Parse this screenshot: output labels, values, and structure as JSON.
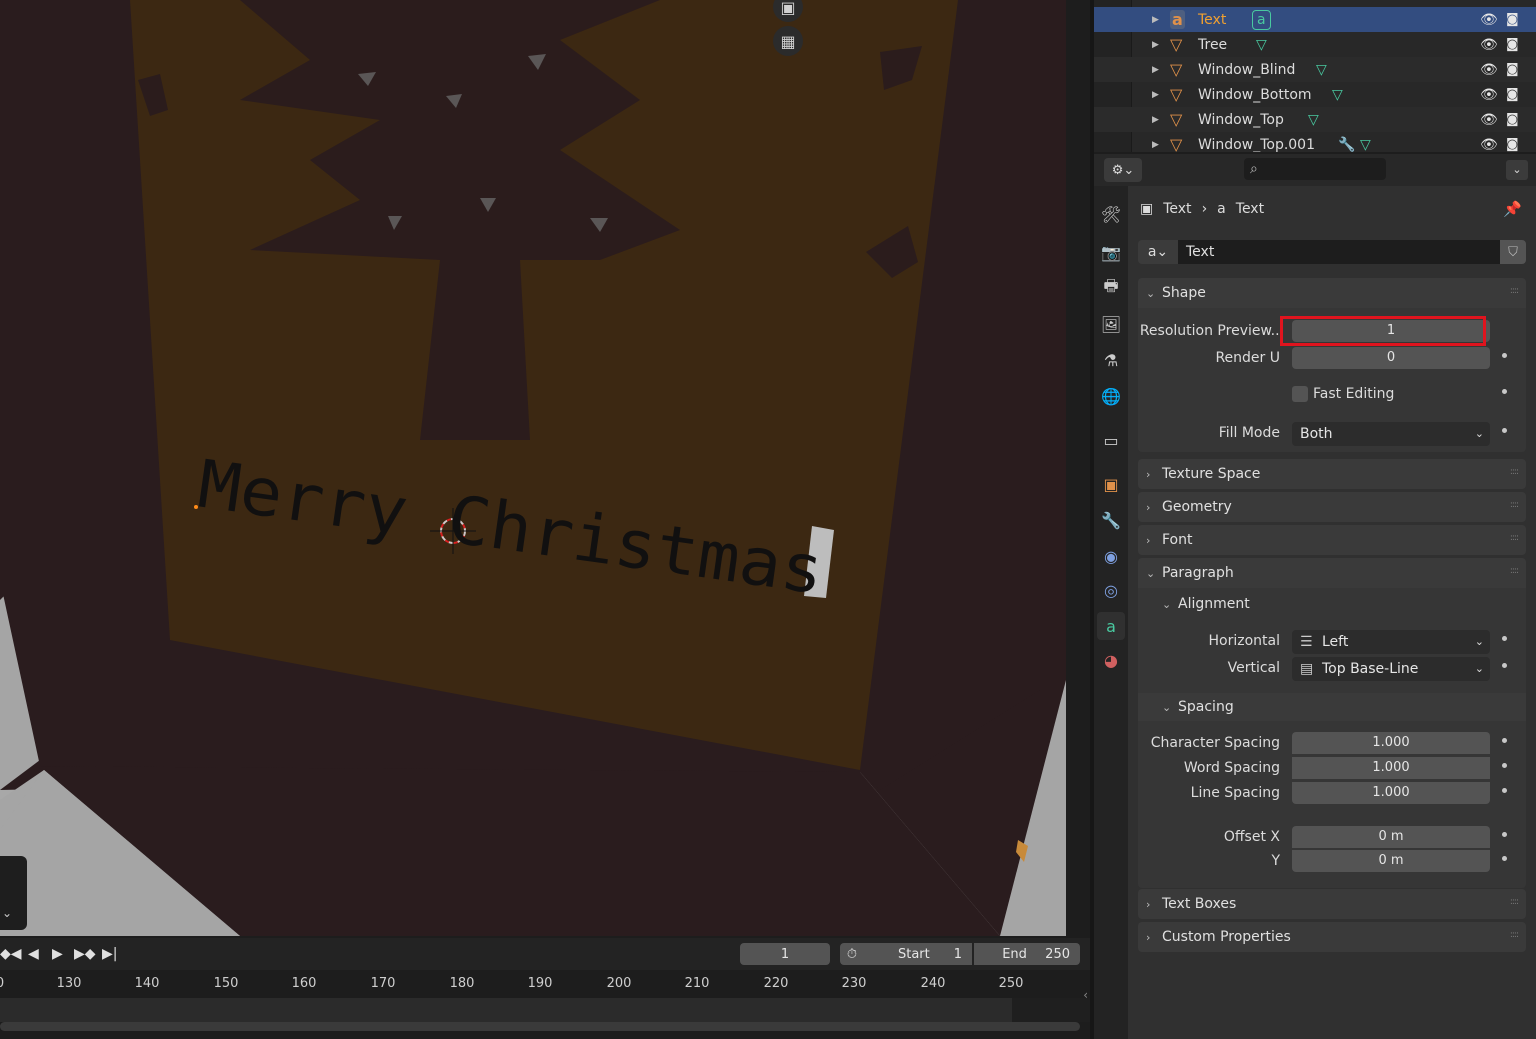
{
  "viewport": {
    "text_object": "Merry Christmas"
  },
  "timeline": {
    "current_frame": "1",
    "start_label": "Start",
    "start_value": "1",
    "end_label": "End",
    "end_value": "250",
    "ruler_ticks": [
      "0",
      "130",
      "140",
      "150",
      "160",
      "170",
      "180",
      "190",
      "200",
      "210",
      "220",
      "230",
      "240",
      "250"
    ]
  },
  "outliner": {
    "rows": [
      {
        "name": "Text",
        "selected": true
      },
      {
        "name": "Tree",
        "selected": false
      },
      {
        "name": "Window_Blind",
        "selected": false
      },
      {
        "name": "Window_Bottom",
        "selected": false
      },
      {
        "name": "Window_Top",
        "selected": false
      },
      {
        "name": "Window_Top.001",
        "selected": false
      }
    ]
  },
  "properties": {
    "breadcrumb_object": "Text",
    "breadcrumb_data": "Text",
    "datablock_name": "Text",
    "shape": {
      "title": "Shape",
      "resolution_preview_label": "Resolution Preview...",
      "resolution_preview_value": "1",
      "render_u_label": "Render U",
      "render_u_value": "0",
      "fast_editing_label": "Fast Editing",
      "fill_mode_label": "Fill Mode",
      "fill_mode_value": "Both"
    },
    "texture_space": "Texture Space",
    "geometry": "Geometry",
    "font": "Font",
    "paragraph": {
      "title": "Paragraph",
      "alignment_title": "Alignment",
      "horizontal_label": "Horizontal",
      "horizontal_value": "Left",
      "vertical_label": "Vertical",
      "vertical_value": "Top Base-Line",
      "spacing_title": "Spacing",
      "char_spacing_label": "Character Spacing",
      "char_spacing_value": "1.000",
      "word_spacing_label": "Word Spacing",
      "word_spacing_value": "1.000",
      "line_spacing_label": "Line Spacing",
      "line_spacing_value": "1.000",
      "offset_x_label": "Offset X",
      "offset_x_value": "0 m",
      "offset_y_label": "Y",
      "offset_y_value": "0 m"
    },
    "text_boxes": "Text Boxes",
    "custom_properties": "Custom Properties"
  },
  "colors": {
    "highlight_box": "#e0141e",
    "selected_row": "#334d80",
    "active_tab": "#49c9a0"
  }
}
